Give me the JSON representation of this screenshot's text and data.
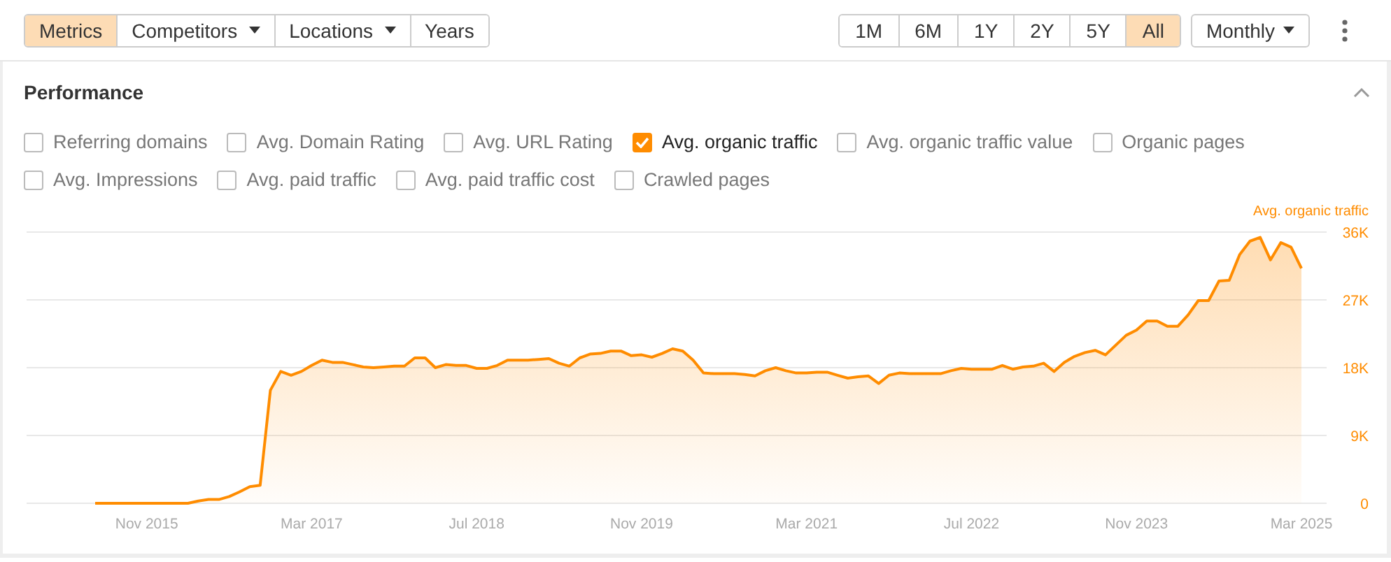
{
  "view_tabs": [
    {
      "label": "Metrics",
      "selected": true,
      "dropdown": false
    },
    {
      "label": "Competitors",
      "selected": false,
      "dropdown": true
    },
    {
      "label": "Locations",
      "selected": false,
      "dropdown": true
    },
    {
      "label": "Years",
      "selected": false,
      "dropdown": false
    }
  ],
  "ranges": [
    {
      "label": "1M",
      "selected": false
    },
    {
      "label": "6M",
      "selected": false
    },
    {
      "label": "1Y",
      "selected": false
    },
    {
      "label": "2Y",
      "selected": false
    },
    {
      "label": "5Y",
      "selected": false
    },
    {
      "label": "All",
      "selected": true
    }
  ],
  "interval": {
    "label": "Monthly"
  },
  "panel": {
    "title": "Performance",
    "expanded": true,
    "metric_rows": [
      [
        {
          "label": "Referring domains",
          "checked": false
        },
        {
          "label": "Avg. Domain Rating",
          "checked": false
        },
        {
          "label": "Avg. URL Rating",
          "checked": false
        },
        {
          "label": "Avg. organic traffic",
          "checked": true
        },
        {
          "label": "Avg. organic traffic value",
          "checked": false
        },
        {
          "label": "Organic pages",
          "checked": false
        }
      ],
      [
        {
          "label": "Avg. Impressions",
          "checked": false
        },
        {
          "label": "Avg. paid traffic",
          "checked": false
        },
        {
          "label": "Avg. paid traffic cost",
          "checked": false
        },
        {
          "label": "Crawled pages",
          "checked": false
        }
      ]
    ],
    "chart_data": {
      "type": "area",
      "categories": [
        null,
        null,
        null,
        null,
        null,
        "Nov 2015",
        null,
        null,
        null,
        null,
        null,
        null,
        null,
        null,
        null,
        null,
        null,
        null,
        null,
        null,
        null,
        "Mar 2017",
        null,
        null,
        null,
        null,
        null,
        null,
        null,
        null,
        null,
        null,
        null,
        null,
        null,
        null,
        null,
        "Jul 2018",
        null,
        null,
        null,
        null,
        null,
        null,
        null,
        null,
        null,
        null,
        null,
        null,
        null,
        null,
        null,
        "Nov 2019",
        null,
        null,
        null,
        null,
        null,
        null,
        null,
        null,
        null,
        null,
        null,
        null,
        null,
        null,
        null,
        "Mar 2021",
        null,
        null,
        null,
        null,
        null,
        null,
        null,
        null,
        null,
        null,
        null,
        null,
        null,
        null,
        null,
        "Jul 2022",
        null,
        null,
        null,
        null,
        null,
        null,
        null,
        null,
        null,
        null,
        null,
        null,
        null,
        null,
        null,
        "Nov 2023",
        null,
        null,
        null,
        null,
        null,
        null,
        null,
        null,
        null,
        null,
        null,
        null,
        null,
        null,
        null,
        "Mar 2025"
      ],
      "series": [
        {
          "name": "Avg. organic traffic",
          "color": "#ff8c00",
          "values": [
            0,
            0,
            0,
            0,
            0,
            0,
            0,
            0,
            0,
            0,
            300,
            500,
            500,
            900,
            1500,
            2200,
            2400,
            15000,
            17500,
            17000,
            17500,
            18300,
            19000,
            18700,
            18700,
            18400,
            18100,
            18000,
            18100,
            18200,
            18200,
            19300,
            19300,
            18000,
            18400,
            18300,
            18300,
            17900,
            17900,
            18300,
            19000,
            19000,
            19000,
            19100,
            19200,
            18600,
            18200,
            19300,
            19800,
            19900,
            20200,
            20200,
            19600,
            19700,
            19400,
            19900,
            20500,
            20200,
            19000,
            17300,
            17200,
            17200,
            17200,
            17100,
            16900,
            17600,
            18000,
            17600,
            17300,
            17300,
            17400,
            17400,
            17000,
            16600,
            16800,
            16900,
            15900,
            17000,
            17300,
            17200,
            17200,
            17200,
            17200,
            17600,
            17900,
            17800,
            17800,
            17800,
            18300,
            17800,
            18100,
            18200,
            18600,
            17500,
            18700,
            19500,
            20000,
            20300,
            19700,
            21000,
            22300,
            23000,
            24200,
            24200,
            23500,
            23500,
            25000,
            26900,
            26900,
            29500,
            29600,
            33000,
            34800,
            35300,
            32300,
            34600,
            34000,
            31200
          ]
        }
      ],
      "ylim": [
        0,
        36000
      ],
      "grid": true,
      "yticks": [
        {
          "value": 0,
          "label": "0"
        },
        {
          "value": 9000,
          "label": "9K"
        },
        {
          "value": 18000,
          "label": "18K"
        },
        {
          "value": 27000,
          "label": "27K"
        },
        {
          "value": 36000,
          "label": "36K"
        }
      ]
    }
  }
}
